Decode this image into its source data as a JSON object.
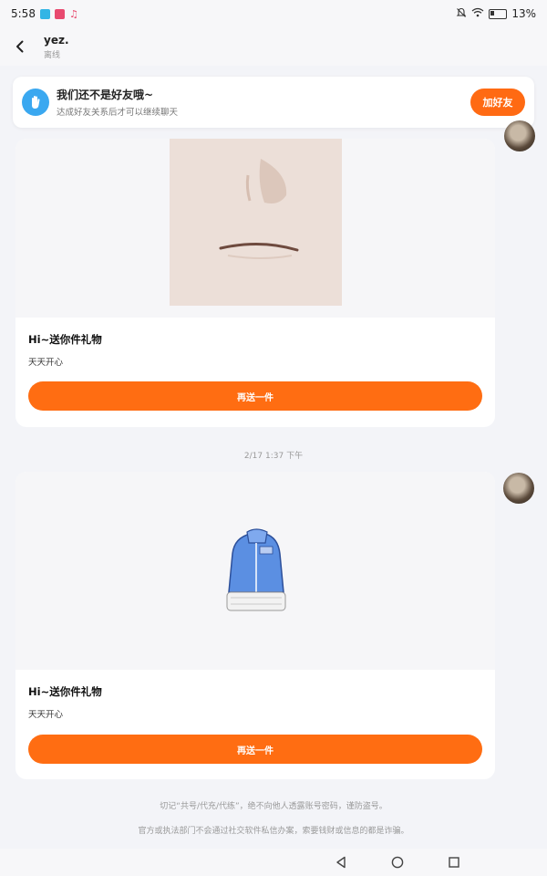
{
  "status_bar": {
    "time": "5:58",
    "battery": "13%",
    "icons": [
      "app-notification-icon",
      "video-app-icon",
      "music-icon",
      "mute-icon",
      "wifi-icon",
      "battery-icon"
    ]
  },
  "header": {
    "contact_name": "yez.",
    "contact_status": "离线",
    "back_icon": "back-arrow-icon"
  },
  "friend_banner": {
    "title": "我们还不是好友哦~",
    "subtitle": "达成好友关系后才可以继续聊天",
    "add_friend_label": "加好友",
    "icon": "hand-wave-icon"
  },
  "messages": [
    {
      "gift_title": "Hi~送你件礼物",
      "gift_message": "天天开心",
      "resend_label": "再送一件",
      "image": "face-sticker"
    },
    {
      "gift_title": "Hi~送你件礼物",
      "gift_message": "天天开心",
      "resend_label": "再送一件",
      "image": "blue-jacket"
    }
  ],
  "timestamp": "2/17 1:37 下午",
  "disclaimer": {
    "line1": "切记“共号/代充/代练”，绝不向他人透露账号密码，谨防盗号。",
    "line2": "官方或执法部门不会通过社交软件私信办案，索要钱财或信息的都是诈骗。"
  },
  "colors": {
    "accent": "#ff6d12",
    "background": "#f3f4f8",
    "card": "#ffffff"
  }
}
